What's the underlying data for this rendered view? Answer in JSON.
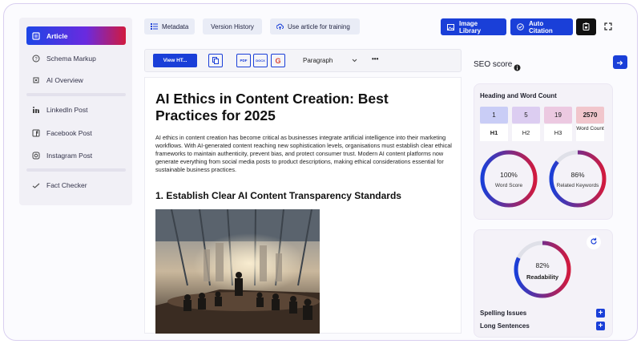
{
  "sidebar": {
    "items": [
      {
        "label": "Article",
        "icon": "document-icon"
      },
      {
        "label": "Schema Markup",
        "icon": "question-icon"
      },
      {
        "label": "AI Overview",
        "icon": "ai-chip-icon"
      },
      {
        "label": "LinkedIn Post",
        "icon": "linkedin-icon"
      },
      {
        "label": "Facebook Post",
        "icon": "facebook-icon"
      },
      {
        "label": "Instagram Post",
        "icon": "instagram-icon"
      },
      {
        "label": "Fact Checker",
        "icon": "check-icon"
      }
    ]
  },
  "toolbar": {
    "metadata": "Metadata",
    "version_history": "Version History",
    "use_article": "Use article for training",
    "image_library": "Image Library",
    "auto_citation": "Auto Citation"
  },
  "editor_toolbar": {
    "view_html": "View HT...",
    "paragraph": "Paragraph",
    "more": "•••",
    "format_labels": [
      "PDF",
      "DOCX",
      "G"
    ]
  },
  "article": {
    "title": "AI Ethics in Content Creation: Best Practices for 2025",
    "intro": "AI ethics in content creation has become critical as businesses integrate artificial intelligence into their marketing workflows. With AI-generated content reaching new sophistication levels, organisations must establish clear ethical frameworks to maintain authenticity, prevent bias, and protect consumer trust. Modern AI content platforms now generate everything from social media posts to product descriptions, making ethical considerations essential for sustainable business practices.",
    "heading": "1. Establish Clear AI Content Transparency Standards"
  },
  "seo": {
    "title": "SEO score",
    "heading_card_title": "Heading and Word Count",
    "counts": [
      {
        "value": "1",
        "label": "H1"
      },
      {
        "value": "5",
        "label": "H2"
      },
      {
        "value": "19",
        "label": "H3"
      },
      {
        "value": "2570",
        "label": "Word Count"
      }
    ],
    "word_score": {
      "value": "100%",
      "label": "Word Score",
      "fraction": 1.0
    },
    "related_keywords": {
      "value": "86%",
      "label": "Related Keywords",
      "fraction": 0.86
    },
    "readability": {
      "value": "82%",
      "label": "Readability",
      "fraction": 0.82
    },
    "issues": [
      "Spelling Issues",
      "Long Sentences"
    ]
  },
  "colors": {
    "accent": "#1a3fd8",
    "gradient_end": "#d11a3e"
  }
}
